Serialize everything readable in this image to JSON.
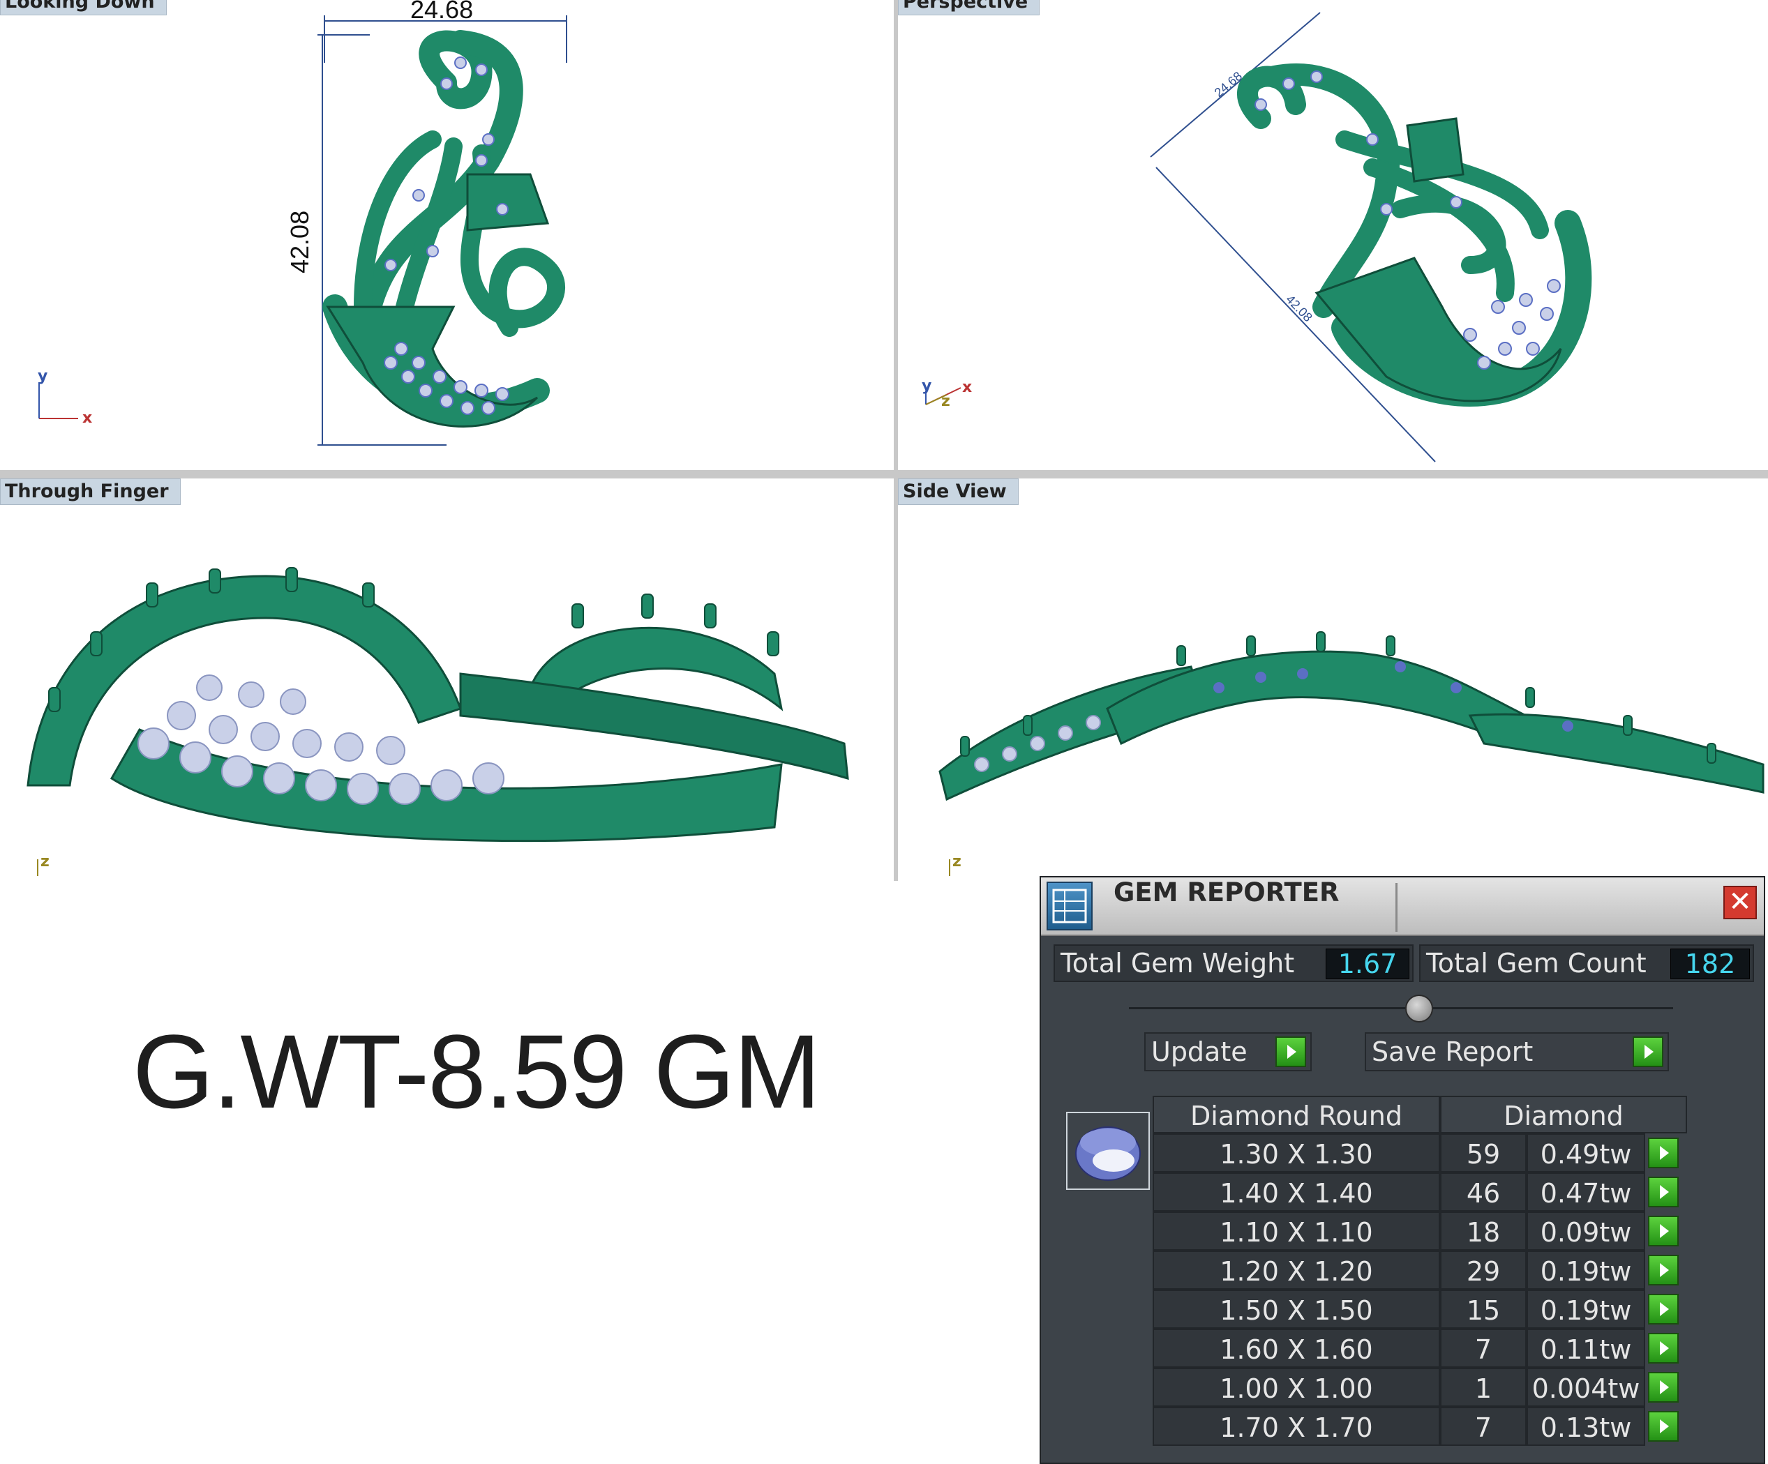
{
  "viewports": {
    "looking_down": {
      "label": "Looking Down",
      "dim_width": "24.68",
      "dim_height": "42.08",
      "axis_y": "y",
      "axis_x": "x"
    },
    "perspective": {
      "label": "Perspective",
      "dim_width": "24.68",
      "dim_height": "42.08",
      "axis_y": "y",
      "axis_z": "z",
      "axis_x": "x"
    },
    "through_finger": {
      "label": "Through Finger",
      "axis_z": "z"
    },
    "side_view": {
      "label": "Side View",
      "axis_z": "z"
    }
  },
  "gross_weight": "G.WT-8.59 GM",
  "gem_reporter": {
    "title": "GEM REPORTER",
    "close": "✕",
    "total_gem_weight_label": "Total Gem Weight",
    "total_gem_weight": "1.67",
    "total_gem_count_label": "Total Gem Count",
    "total_gem_count": "182",
    "update_label": "Update",
    "save_report_label": "Save Report",
    "columns": {
      "shape": "Diamond Round",
      "material": "Diamond"
    },
    "rows": [
      {
        "size": "1.30 X 1.30",
        "count": "59",
        "weight": "0.49tw"
      },
      {
        "size": "1.40 X 1.40",
        "count": "46",
        "weight": "0.47tw"
      },
      {
        "size": "1.10 X 1.10",
        "count": "18",
        "weight": "0.09tw"
      },
      {
        "size": "1.20 X 1.20",
        "count": "29",
        "weight": "0.19tw"
      },
      {
        "size": "1.50 X 1.50",
        "count": "15",
        "weight": "0.19tw"
      },
      {
        "size": "1.60 X 1.60",
        "count": "7",
        "weight": "0.11tw"
      },
      {
        "size": "1.00 X 1.00",
        "count": "1",
        "weight": "0.004tw"
      },
      {
        "size": "1.70 X 1.70",
        "count": "7",
        "weight": "0.13tw"
      }
    ]
  },
  "colors": {
    "metal": "#1f8a68",
    "metal_dark": "#0f4e3a",
    "stone_blue": "#5b6fc4",
    "stone_pale": "#c9d0e8",
    "dimension_line": "#2f4f8f",
    "panel_bg": "#3d4349",
    "value_cyan": "#46d6ee"
  }
}
